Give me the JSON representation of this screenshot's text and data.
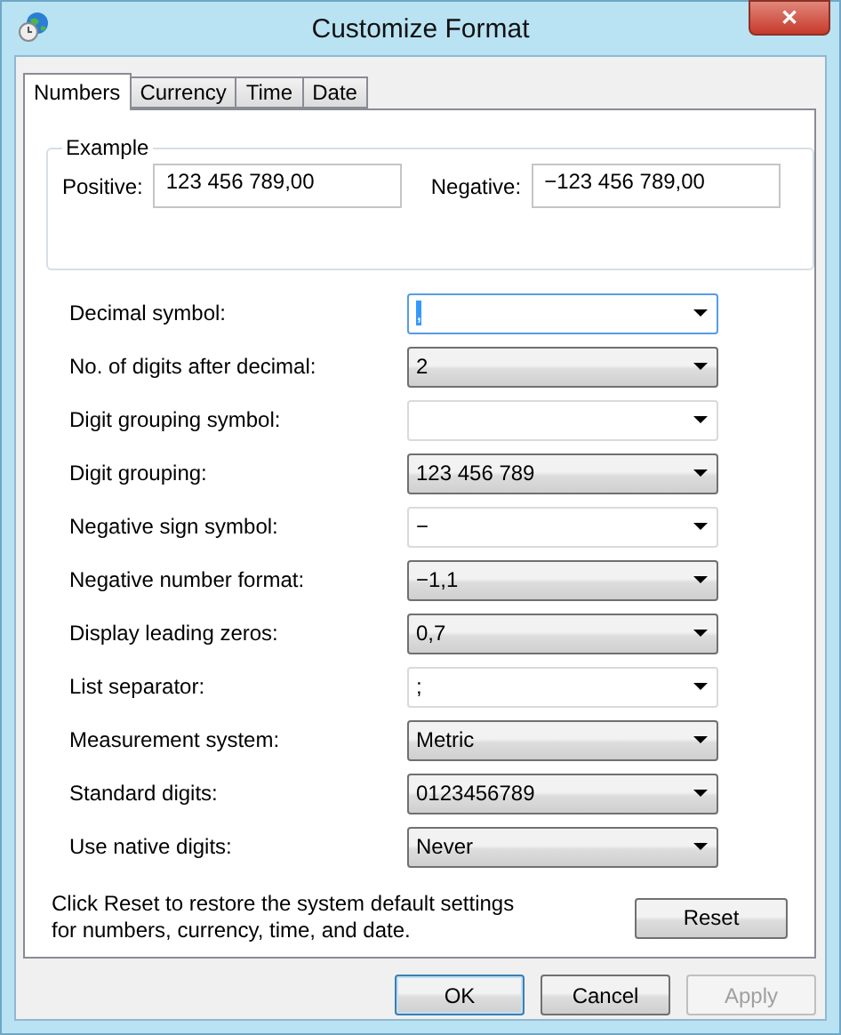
{
  "window": {
    "title": "Customize Format",
    "close": "✕"
  },
  "tabs": [
    {
      "label": "Numbers",
      "selected": true
    },
    {
      "label": "Currency",
      "selected": false
    },
    {
      "label": "Time",
      "selected": false
    },
    {
      "label": "Date",
      "selected": false
    }
  ],
  "example": {
    "title": "Example",
    "positive_label": "Positive:",
    "positive": "123 456 789,00",
    "negative_label": "Negative:",
    "negative": "−123 456 789,00"
  },
  "settings": [
    {
      "label": "Decimal symbol:",
      "value": ",",
      "kind": "editable",
      "focused": true
    },
    {
      "label": "No. of digits after decimal:",
      "value": "2",
      "kind": "list",
      "focused": false
    },
    {
      "label": "Digit grouping symbol:",
      "kind": "editable",
      "focused": false
    },
    {
      "label": "Digit grouping:",
      "value": "123 456 789",
      "kind": "list",
      "focused": false
    },
    {
      "label": "Negative sign symbol:",
      "value": "−",
      "kind": "editable",
      "focused": false
    },
    {
      "label": "Negative number format:",
      "value": "−1,1",
      "kind": "list",
      "focused": false
    },
    {
      "label": "Display leading zeros:",
      "value": "0,7",
      "kind": "list",
      "focused": false
    },
    {
      "label": "List separator:",
      "value": ";",
      "kind": "editable",
      "focused": false
    },
    {
      "label": "Measurement system:",
      "value": "Metric",
      "kind": "list",
      "focused": false
    },
    {
      "label": "Standard digits:",
      "value": "0123456789",
      "kind": "list",
      "focused": false
    },
    {
      "label": "Use native digits:",
      "value": "Never",
      "kind": "list",
      "focused": false
    }
  ],
  "reset_note": "Click Reset to restore the system default settings for numbers, currency, time, and date.",
  "reset_button": "Reset",
  "buttons": [
    {
      "label": "OK",
      "default": true,
      "disabled": false
    },
    {
      "label": "Cancel",
      "default": false,
      "disabled": false
    },
    {
      "label": "Apply",
      "default": false,
      "disabled": true
    }
  ]
}
